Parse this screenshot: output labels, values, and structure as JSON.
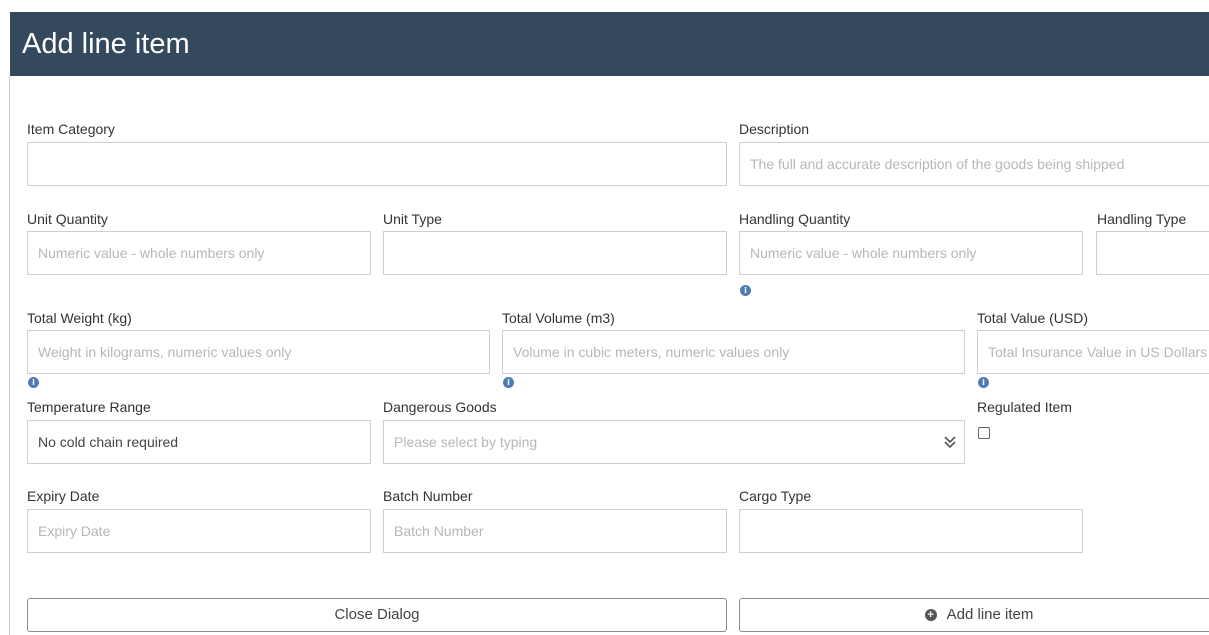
{
  "dialog": {
    "title": "Add line item"
  },
  "fields": {
    "item_category": {
      "label": "Item Category",
      "placeholder": ""
    },
    "description": {
      "label": "Description",
      "placeholder": "The full and accurate description of the goods being shipped"
    },
    "unit_quantity": {
      "label": "Unit Quantity",
      "placeholder": "Numeric value - whole numbers only"
    },
    "unit_type": {
      "label": "Unit Type",
      "placeholder": ""
    },
    "handling_quantity": {
      "label": "Handling Quantity",
      "placeholder": "Numeric value - whole numbers only"
    },
    "handling_type": {
      "label": "Handling Type",
      "placeholder": ""
    },
    "total_weight": {
      "label": "Total Weight (kg)",
      "placeholder": "Weight in kilograms, numeric values only"
    },
    "total_volume": {
      "label": "Total Volume (m3)",
      "placeholder": "Volume in cubic meters, numeric values only"
    },
    "total_value": {
      "label": "Total Value (USD)",
      "placeholder": "Total Insurance Value in US Dollars"
    },
    "temperature_range": {
      "label": "Temperature Range",
      "value": "No cold chain required"
    },
    "dangerous_goods": {
      "label": "Dangerous Goods",
      "placeholder": "Please select by typing"
    },
    "regulated_item": {
      "label": "Regulated Item",
      "checked": false
    },
    "expiry_date": {
      "label": "Expiry Date",
      "placeholder": "Expiry Date"
    },
    "batch_number": {
      "label": "Batch Number",
      "placeholder": "Batch Number"
    },
    "cargo_type": {
      "label": "Cargo Type",
      "placeholder": ""
    }
  },
  "buttons": {
    "close": "Close Dialog",
    "add": "Add line item"
  },
  "icons": {
    "info": "info-icon",
    "dropdown": "double-chevron-down-icon",
    "add": "plus-circle-icon"
  },
  "colors": {
    "header_bg": "#34495e",
    "info_icon": "#4f7bb4"
  }
}
